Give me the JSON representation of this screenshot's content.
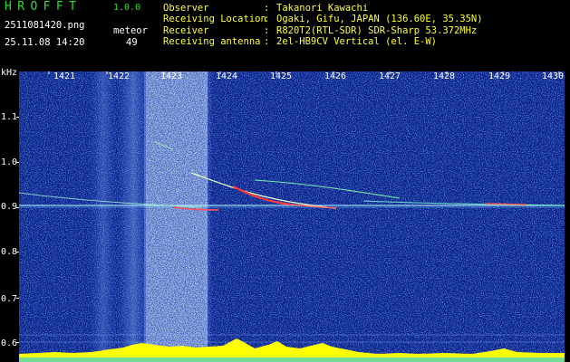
{
  "header": {
    "brand": "HROFFT",
    "version": "1.0.0",
    "filename": "2511081420.png",
    "mode": "meteor",
    "datetime": "25.11.08 14:20",
    "count": "49"
  },
  "info": {
    "observer_label": "Observer",
    "observer_value": "Takanori Kawachi",
    "location_label": "Receiving Location",
    "location_value": "Ogaki, Gifu, JAPAN (136.60E, 35.35N)",
    "receiver_label": "Receiver",
    "receiver_value": "R820T2(RTL-SDR) SDR-Sharp 53.372MHz",
    "antenna_label": "Receiving antenna",
    "antenna_value": "2el-HB9CV Vertical (el. E-W)",
    "colon": ":"
  },
  "spectrogram": {
    "y_unit": "kHz",
    "y_ticks": [
      "1.1",
      "1.0",
      "0.9",
      "0.8",
      "0.7",
      "0.6"
    ],
    "x_ticks": [
      "1421",
      "1422",
      "1423",
      "1424",
      "1425",
      "1426",
      "1427",
      "1428",
      "1429",
      "1430"
    ],
    "colors": {
      "background": "#0a1f8a",
      "noise": "#2f7cff",
      "signal": "#ffffff",
      "echo": "#ff4040",
      "level": "#ffff00",
      "text_green": "#2fe02f",
      "text_yellow": "#ffff3a"
    }
  }
}
